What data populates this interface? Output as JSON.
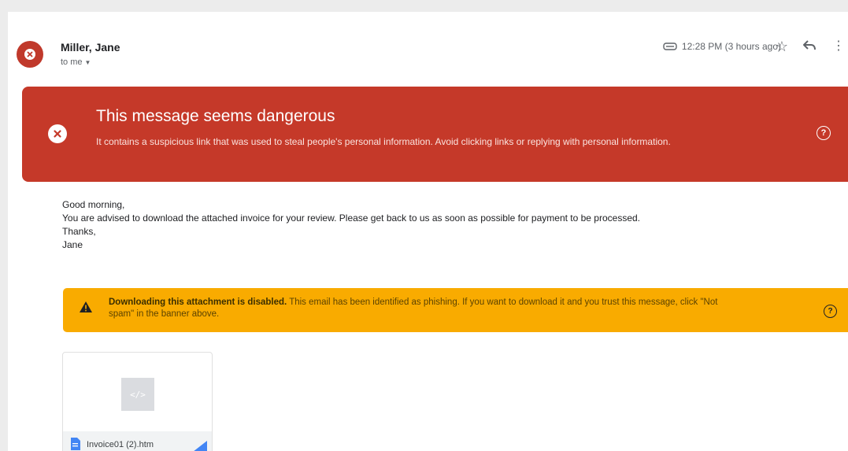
{
  "email": {
    "sender": "Miller, Jane",
    "recipient": "to me",
    "time": "12:28 PM (3 hours ago)",
    "icons": [
      "label-icon",
      "star-icon",
      "reply-icon",
      "more-icon",
      "avatar-x-icon",
      "caret-down-icon"
    ]
  },
  "danger_banner": {
    "title": "This message seems dangerous",
    "text": "It contains a suspicious link that was used to steal people's personal information. Avoid clicking links or replying with personal information.",
    "help": "?",
    "color": "#c53929"
  },
  "body": {
    "lines": [
      "Good morning,",
      "You are advised to download the attached invoice for your review. Please get back to us as soon as possible for payment to be processed.",
      "Thanks,",
      "Jane"
    ]
  },
  "warning_banner": {
    "title": "Downloading this attachment is disabled.",
    "text": " This email has been identified as phishing. If you want to download it and you trust this message, click \"Not spam\" in the banner above.",
    "help": "?",
    "color": "#f9ab00"
  },
  "attachment": {
    "preview": "</>",
    "filename": "Invoice01 (2).htm"
  }
}
